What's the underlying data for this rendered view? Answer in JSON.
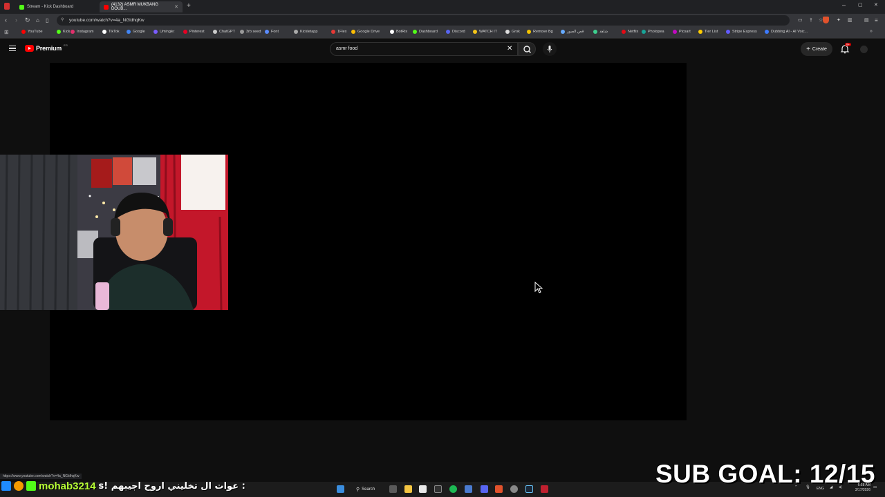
{
  "browser": {
    "tabs": [
      {
        "title": "Stream - Kick Dashboard",
        "active": false,
        "favicon_color": "#53fc18"
      },
      {
        "title": "(4132) ASMR MUKBANG DOUB...",
        "active": true,
        "favicon_color": "#ff0000"
      }
    ],
    "new_tab_label": "+",
    "url": "youtube.com/watch?v=4a_NGldhqKw",
    "bookmarks": [
      {
        "label": "YouTube",
        "color": "#ff0000"
      },
      {
        "label": "Kick",
        "color": "#53fc18"
      },
      {
        "label": "Instagram",
        "color": "#e1306c"
      },
      {
        "label": "TikTok",
        "color": "#ffffff"
      },
      {
        "label": "Google",
        "color": "#4285f4"
      },
      {
        "label": "Umingle:",
        "color": "#7a5cff"
      },
      {
        "label": "Pinterest",
        "color": "#e60023"
      },
      {
        "label": "ChatGPT",
        "color": "#cccccc"
      },
      {
        "label": "3rb seed",
        "color": "#999999"
      },
      {
        "label": "Font",
        "color": "#5b8cff"
      },
      {
        "label": "Kickletapp",
        "color": "#aaaaaa"
      },
      {
        "label": "1Flex",
        "color": "#e53935"
      },
      {
        "label": "Google Drive",
        "color": "#fbbc04"
      },
      {
        "label": "BotRix",
        "color": "#ffffff"
      },
      {
        "label": "Dashboard",
        "color": "#53fc18"
      },
      {
        "label": "Discord",
        "color": "#5865f2"
      },
      {
        "label": "WATCH IT",
        "color": "#f5c518"
      },
      {
        "label": "Grok",
        "color": "#dddddd"
      },
      {
        "label": "Remove Bg",
        "color": "#f2c200"
      },
      {
        "label": "قص الصور",
        "color": "#66aaff"
      },
      {
        "label": "شاهد",
        "color": "#3ecf8e"
      },
      {
        "label": "Netflix",
        "color": "#e50914"
      },
      {
        "label": "Photopea",
        "color": "#18a497"
      },
      {
        "label": "Picsart",
        "color": "#c209c1"
      },
      {
        "label": "Tier List",
        "color": "#ffcc00"
      },
      {
        "label": "Stripe Express",
        "color": "#635bff"
      },
      {
        "label": "Dubbing AI - AI Voic...",
        "color": "#3d7bff"
      }
    ]
  },
  "youtube": {
    "logo_label": "Premium",
    "logo_badge": "EG",
    "search_value": "asmr food",
    "create_label": "Create",
    "notification_badge": "9+"
  },
  "overlay": {
    "chat_user": "mohab3214",
    "chat_message": ": عوات ال تخليني اروح اجيبهم !s",
    "sub_goal": "SUB GOAL: 12/15"
  },
  "status_url": "https://www.youtube.com/watch?v=4a_NGldhqKw",
  "taskbar": {
    "search_label": "Search",
    "language": "ENG",
    "time": "6:58 AM",
    "date": "3/17/2026"
  }
}
